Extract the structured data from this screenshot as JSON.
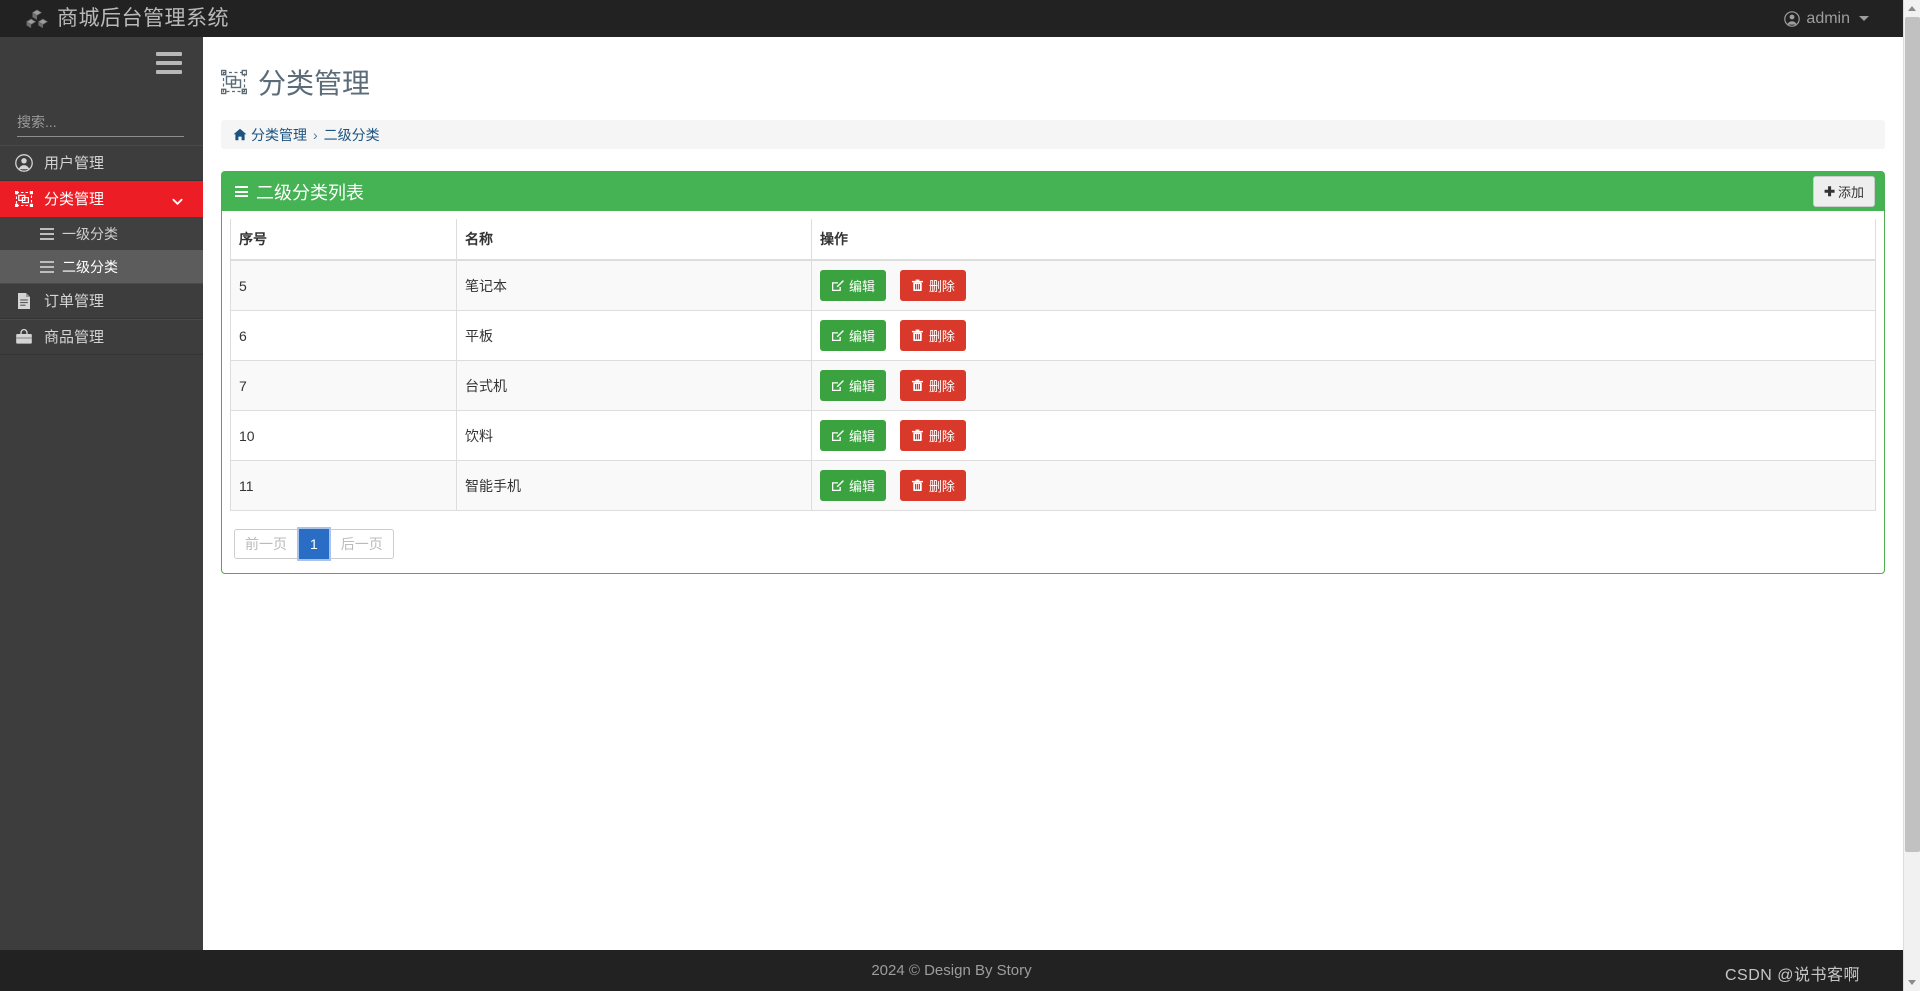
{
  "navbar": {
    "brand_icon": "cubes-icon",
    "brand_title": "商城后台管理系统",
    "user_icon": "user-circle-icon",
    "user_name": "admin",
    "caret_icon": "caret-down-icon"
  },
  "sidebar": {
    "hamburger_icon": "hamburger-icon",
    "search": {
      "placeholder": "搜索...",
      "value": ""
    },
    "items": [
      {
        "label": "用户管理",
        "icon": "user-circle-icon",
        "active": false
      },
      {
        "label": "分类管理",
        "icon": "object-group-icon",
        "active": true,
        "caret": "chevron-down-icon"
      },
      {
        "label": "订单管理",
        "icon": "file-text-icon",
        "active": false
      },
      {
        "label": "商品管理",
        "icon": "briefcase-icon",
        "active": false
      }
    ],
    "submenu": [
      {
        "label": "一级分类",
        "icon": "list-icon",
        "active": false
      },
      {
        "label": "二级分类",
        "icon": "list-icon",
        "active": true
      }
    ]
  },
  "page": {
    "title": "分类管理",
    "title_icon": "object-group-icon",
    "breadcrumb": {
      "home_icon": "home-icon",
      "parent": "分类管理",
      "separator": "›",
      "current": "二级分类"
    }
  },
  "panel": {
    "heading_icon": "bars-icon",
    "heading_title": "二级分类列表",
    "add_button": {
      "label": "添加",
      "icon": "plus-icon",
      "glyph": "✚"
    }
  },
  "table": {
    "columns": [
      "序号",
      "名称",
      "操作"
    ],
    "rows": [
      {
        "id": "5",
        "name": "笔记本"
      },
      {
        "id": "6",
        "name": "平板"
      },
      {
        "id": "7",
        "name": "台式机"
      },
      {
        "id": "10",
        "name": "饮料"
      },
      {
        "id": "11",
        "name": "智能手机"
      }
    ],
    "row_actions": {
      "edit": {
        "label": "编辑",
        "icon": "pencil-square-icon"
      },
      "delete": {
        "label": "删除",
        "icon": "trash-icon"
      }
    }
  },
  "pagination": {
    "prev": "前一页",
    "current": "1",
    "next": "后一页"
  },
  "footer": {
    "text": "2024 © Design By Story",
    "watermark": "CSDN @说书客啊"
  },
  "colors": {
    "navbar_bg": "#222222",
    "sidebar_bg": "#3d3d3d",
    "accent_red": "#ec1d24",
    "panel_green": "#45b254",
    "btn_edit_green": "#3aa33f",
    "btn_delete_red": "#d9392b",
    "page_active_blue": "#2a6dc4",
    "breadcrumb_link": "#1c5380",
    "title_gray": "#5b6b78"
  }
}
